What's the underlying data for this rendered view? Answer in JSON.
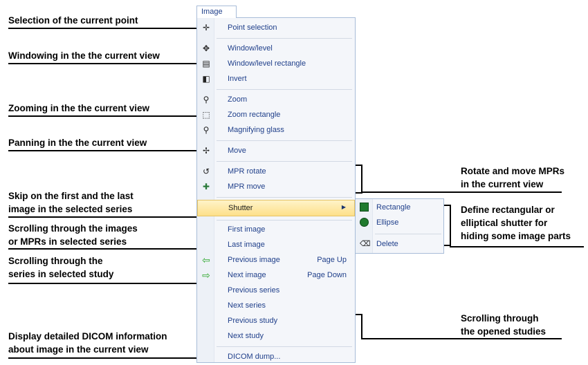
{
  "menu": {
    "title": "Image",
    "items": [
      {
        "label": "Point selection",
        "icon": "point-selection-icon",
        "glyph": "✛"
      },
      {
        "label": "Window/level",
        "icon": "window-level-icon",
        "glyph": "✥"
      },
      {
        "label": "Window/level rectangle",
        "icon": "window-level-rect-icon",
        "glyph": "▤"
      },
      {
        "label": "Invert",
        "icon": "invert-icon",
        "glyph": "◧"
      },
      {
        "label": "Zoom",
        "icon": "zoom-icon",
        "glyph": "⚲"
      },
      {
        "label": "Zoom rectangle",
        "icon": "zoom-rect-icon",
        "glyph": "⬚"
      },
      {
        "label": "Magnifying glass",
        "icon": "magnifier-icon",
        "glyph": "⚲"
      },
      {
        "label": "Move",
        "icon": "move-icon",
        "glyph": "✢"
      },
      {
        "label": "MPR rotate",
        "icon": "mpr-rotate-icon",
        "glyph": "↺"
      },
      {
        "label": "MPR move",
        "icon": "mpr-move-icon",
        "glyph": "✚"
      },
      {
        "label": "Shutter",
        "icon": "",
        "glyph": ""
      },
      {
        "label": "First image",
        "icon": "",
        "glyph": ""
      },
      {
        "label": "Last image",
        "icon": "",
        "glyph": ""
      },
      {
        "label": "Previous image",
        "icon": "arrow-left-icon",
        "glyph": "⇦",
        "shortcut": "Page Up"
      },
      {
        "label": "Next image",
        "icon": "arrow-right-icon",
        "glyph": "⇨",
        "shortcut": "Page Down"
      },
      {
        "label": "Previous series",
        "icon": "",
        "glyph": ""
      },
      {
        "label": "Next series",
        "icon": "",
        "glyph": ""
      },
      {
        "label": "Previous study",
        "icon": "",
        "glyph": ""
      },
      {
        "label": "Next study",
        "icon": "",
        "glyph": ""
      },
      {
        "label": "DICOM dump...",
        "icon": "",
        "glyph": ""
      }
    ],
    "submenu_arrow": "▶"
  },
  "submenu": {
    "items": [
      {
        "label": "Rectangle",
        "icon": "rectangle-shutter-icon"
      },
      {
        "label": "Ellipse",
        "icon": "ellipse-shutter-icon"
      },
      {
        "label": "Delete",
        "icon": "eraser-icon"
      }
    ]
  },
  "annotations": {
    "point": "Selection of the current point",
    "window": "Windowing in the the current view",
    "zoom": "Zooming in the the current view",
    "pan": "Panning in the the current view",
    "skip": "Skip on the first and the last\nimage in the selected series",
    "scroll_images": "Scrolling through the images\nor MPRs in selected series",
    "scroll_series": "Scrolling through the\nseries in selected study",
    "dicom": "Display detailed DICOM information\nabout image in the current view",
    "mpr": "Rotate and move MPRs\nin the current view",
    "shutter": "Define rectangular or\nelliptical shutter for\nhiding some image parts",
    "studies": "Scrolling through\nthe opened studies"
  },
  "colors": {
    "highlight": "#fde08a",
    "menu_text": "#1f3f8a",
    "green_arrow": "#2fa82f"
  }
}
